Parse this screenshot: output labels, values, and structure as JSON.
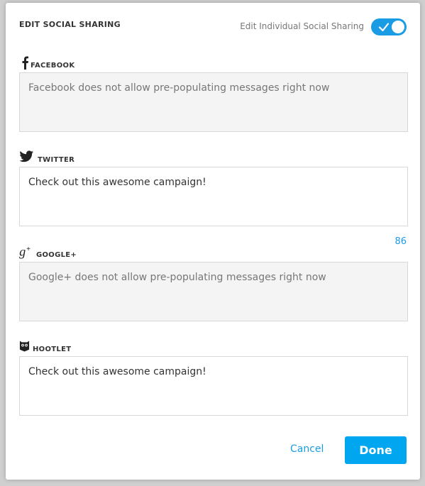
{
  "modal": {
    "title": "EDIT SOCIAL SHARING",
    "toggle_label": "Edit Individual Social Sharing",
    "toggle_on": true,
    "accent_color": "#1a9ce5"
  },
  "sections": [
    {
      "icon": "facebook-icon",
      "label": "FACEBOOK",
      "message": "Facebook does not allow pre-populating messages right now",
      "editable": false
    },
    {
      "icon": "twitter-icon",
      "label": "TWITTER",
      "message": "Check out this awesome campaign!",
      "editable": true,
      "char_count": "86"
    },
    {
      "icon": "google-plus-icon",
      "label": "GOOGLE+",
      "message": "Google+ does not allow pre-populating messages right now",
      "editable": false
    },
    {
      "icon": "hootlet-icon",
      "label": "HOOTLET",
      "message": "Check out this awesome campaign!",
      "editable": true
    }
  ],
  "footer": {
    "cancel_label": "Cancel",
    "done_label": "Done"
  }
}
